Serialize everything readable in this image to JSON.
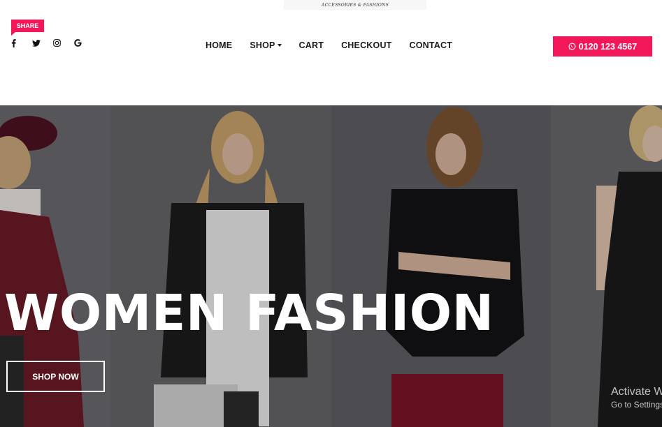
{
  "header": {
    "logo_tagline": "ACCESSORIES & FASHIONS",
    "share_label": "SHARE",
    "social_icons": [
      "facebook-icon",
      "twitter-icon",
      "instagram-icon",
      "google-icon"
    ],
    "nav": {
      "home": "HOME",
      "shop": "SHOP",
      "cart": "CART",
      "checkout": "CHECKOUT",
      "contact": "CONTACT"
    },
    "phone_icon": "whatsapp-icon",
    "phone": "0120 123 4567"
  },
  "hero": {
    "title": "WOMEN FASHION",
    "cta": "SHOP NOW"
  },
  "watermark": {
    "line1": "Activate W",
    "line2": "Go to Settings"
  },
  "colors": {
    "accent": "#f21759",
    "hero_bg": "#5e5e62"
  }
}
